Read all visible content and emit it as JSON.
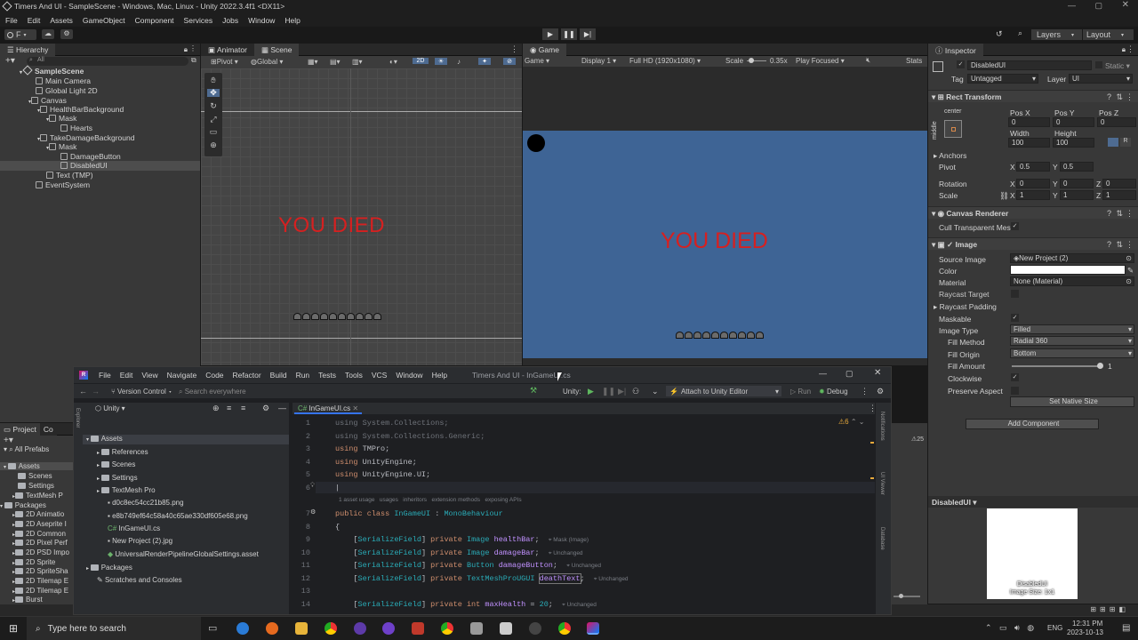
{
  "window": {
    "title": "Timers And UI - SampleScene - Windows, Mac, Linux - Unity 2022.3.4f1 <DX11>"
  },
  "menu": [
    "File",
    "Edit",
    "Assets",
    "GameObject",
    "Component",
    "Services",
    "Jobs",
    "Window",
    "Help"
  ],
  "toolbar": {
    "account": "F",
    "layers": "Layers",
    "layout": "Layout"
  },
  "hierarchy": {
    "tab": "Hierarchy",
    "search": "All",
    "items": [
      "SampleScene",
      "Main Camera",
      "Global Light 2D",
      "Canvas",
      "HealthBarBackground",
      "Mask",
      "Hearts",
      "TakeDamageBackground",
      "Mask",
      "DamageButton",
      "DisabledUI",
      "Text (TMP)",
      "EventSystem"
    ]
  },
  "scene": {
    "tabs": [
      "Animator",
      "Scene"
    ],
    "pivot": "Pivot",
    "global": "Global",
    "mode2d": "2D",
    "text": "YOU DIED"
  },
  "game": {
    "tab": "Game",
    "view": "Game",
    "display": "Display 1",
    "resolution": "Full HD (1920x1080)",
    "scale_label": "Scale",
    "scale": "0.35x",
    "play": "Play Focused",
    "stats": "Stats",
    "text": "YOU DIED"
  },
  "inspector": {
    "tab": "Inspector",
    "object": "DisabledUI",
    "static": "Static",
    "tag_label": "Tag",
    "tag": "Untagged",
    "layer_label": "Layer",
    "layer": "UI",
    "rect": {
      "title": "Rect Transform",
      "anchor_h": "center",
      "anchor_v": "middle",
      "posx_l": "Pos X",
      "posy_l": "Pos Y",
      "posz_l": "Pos Z",
      "posx": "0",
      "posy": "0",
      "posz": "0",
      "w_l": "Width",
      "h_l": "Height",
      "w": "100",
      "h": "100",
      "anchors": "Anchors",
      "pivot": "Pivot",
      "pivx": "0.5",
      "pivy": "0.5",
      "rotation": "Rotation",
      "rx": "0",
      "ry": "0",
      "rz": "0",
      "scale": "Scale",
      "sx": "1",
      "sy": "1",
      "sz": "1",
      "x": "X",
      "y": "Y",
      "z": "Z"
    },
    "canvas_renderer": {
      "title": "Canvas Renderer",
      "cull": "Cull Transparent Mes"
    },
    "image": {
      "title": "Image",
      "source_l": "Source Image",
      "source": "New Project (2)",
      "color_l": "Color",
      "material_l": "Material",
      "material": "None (Material)",
      "raycast_l": "Raycast Target",
      "padding_l": "Raycast Padding",
      "maskable_l": "Maskable",
      "type_l": "Image Type",
      "type": "Filled",
      "fill_method_l": "Fill Method",
      "fill_method": "Radial 360",
      "fill_origin_l": "Fill Origin",
      "fill_origin": "Bottom",
      "fill_amount_l": "Fill Amount",
      "fill_amount": "1",
      "clockwise_l": "Clockwise",
      "preserve_l": "Preserve Aspect",
      "native": "Set Native Size",
      "add_component": "Add Component"
    },
    "preview": {
      "title": "DisabledUI",
      "caption1": "DisabledUI",
      "caption2": "Image Size: 1x1"
    }
  },
  "project": {
    "tabs": [
      "Project",
      "Co"
    ],
    "favorites": "All Prefabs",
    "items": [
      "Assets",
      "Scenes",
      "Settings",
      "TextMesh P",
      "Packages",
      "2D Animatio",
      "2D Aseprite I",
      "2D Common",
      "2D Pixel Perf",
      "2D PSD Impo",
      "2D Sprite",
      "2D SpriteSha",
      "2D Tilemap E",
      "2D Tilemap E",
      "Burst"
    ]
  },
  "rider": {
    "title": "Timers And UI - InGameUI.cs",
    "menu": [
      "File",
      "Edit",
      "View",
      "Navigate",
      "Code",
      "Refactor",
      "Build",
      "Run",
      "Tests",
      "Tools",
      "VCS",
      "Window",
      "Help"
    ],
    "vcs": "Version Control",
    "search": "Search everywhere",
    "unity": "Unity:",
    "attach": "Attach to Unity Editor",
    "run": "Run",
    "debug": "Debug",
    "tree_root": "Unity",
    "tree": [
      "Assets",
      "References",
      "Scenes",
      "Settings",
      "TextMesh Pro",
      "d0c8ec54cc21b85.png",
      "e8b749ef64c58a40c65ae330df605e68.png",
      "InGameUI.cs",
      "New Project (2).jpg",
      "UniversalRenderPipelineGlobalSettings.asset",
      "Packages",
      "Scratches and Consoles"
    ],
    "file_tab": "InGameUI.cs",
    "warnings": "6",
    "usage_hints": [
      "1 asset usage",
      "usages",
      "inheritors",
      "extension methods",
      "exposing APIs"
    ],
    "hint_mask": "Mask (Image)",
    "hint_unchanged": "Unchanged",
    "side_labels": [
      "Notifications",
      "UI Viewer",
      "Database"
    ],
    "side_count": "25"
  },
  "taskbar": {
    "search": "Type here to search",
    "time": "12:31 PM",
    "date": "2023-10-13",
    "lang": "ENG"
  }
}
